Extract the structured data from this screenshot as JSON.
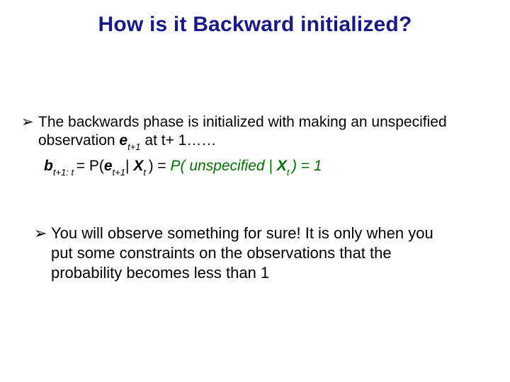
{
  "title": "How is it Backward initialized?",
  "bullet_glyph": "➢",
  "p1": {
    "lead": "The backwards phase is initialized with making an unspecified",
    "line2_a": "observation ",
    "e": "e",
    "t1": "t+1",
    "line2_b": " at  t+ 1……"
  },
  "formula": {
    "b": "b",
    "b_sub": "t+1: t ",
    "eq1": " = ",
    "P1": "P(",
    "e2": "e",
    "e2_sub": "t+1",
    "bar": "| ",
    "X1": "X",
    "X1_sub": "t ",
    "close1": ") = ",
    "rhs_open": "P( unspecified | ",
    "X2": "X",
    "X2_sub": "t ",
    "rhs_close": ") = 1"
  },
  "p2": {
    "lead": "You will observe something for sure! It is only when you",
    "line2": "put some constraints on the observations that the",
    "line3": "probability becomes less than 1"
  }
}
